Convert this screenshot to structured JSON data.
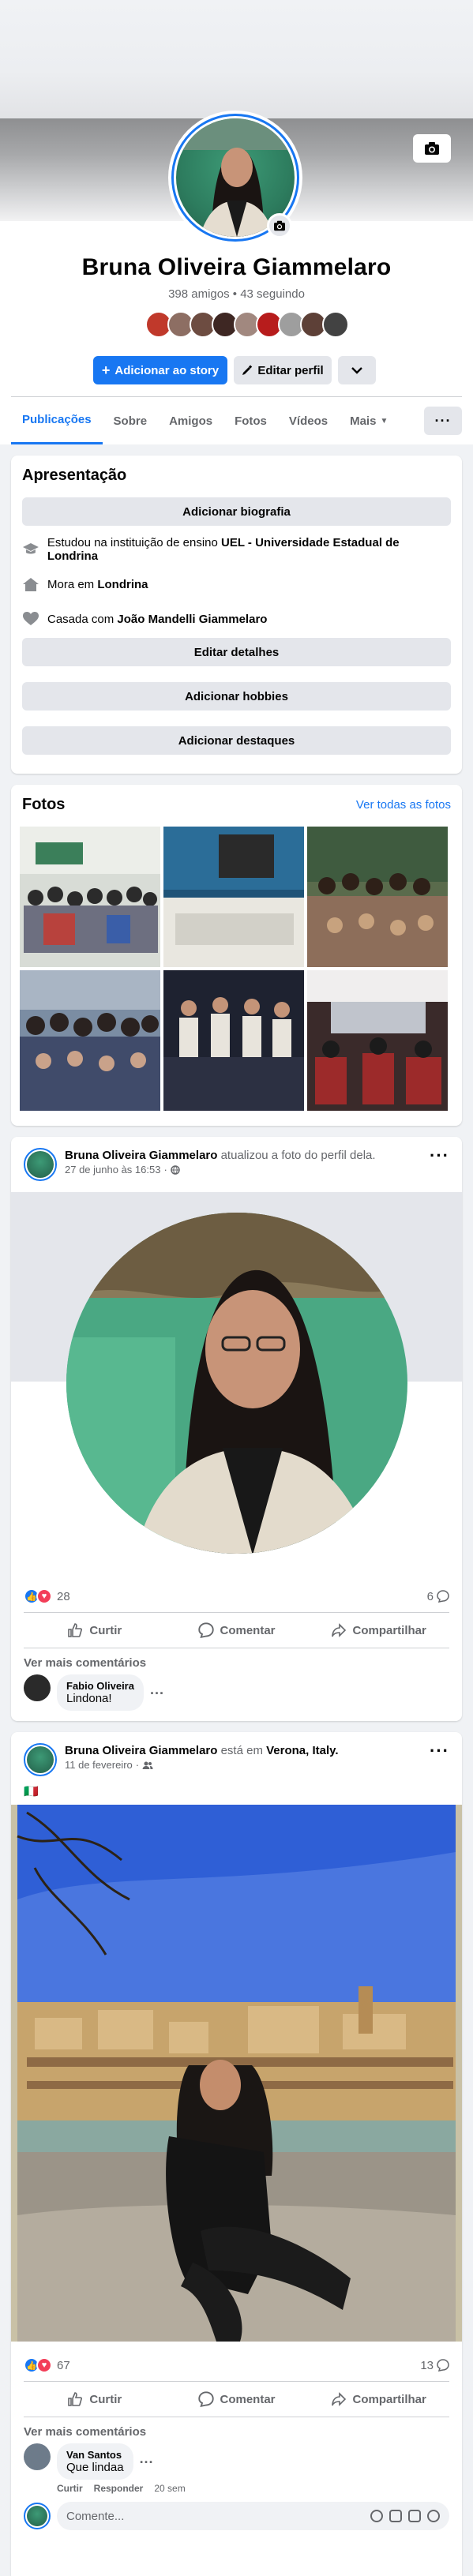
{
  "profile": {
    "name": "Bruna Oliveira Giammelaro",
    "counts": "398 amigos • 43 seguindo",
    "add_story": "Adicionar ao story",
    "edit_profile": "Editar perfil"
  },
  "tabs": [
    "Publicações",
    "Sobre",
    "Amigos",
    "Fotos",
    "Vídeos",
    "Mais"
  ],
  "intro": {
    "title": "Apresentação",
    "add_bio": "Adicionar biografia",
    "study_prefix": "Estudou na instituição de ensino",
    "study_place": "UEL - Universidade Estadual de Londrina",
    "lives_prefix": "Mora em",
    "lives_place": "Londrina",
    "married_prefix": "Casada com",
    "married_to": "João Mandelli Giammelaro",
    "edit_details": "Editar detalhes",
    "add_hobbies": "Adicionar hobbies",
    "add_highlights": "Adicionar destaques"
  },
  "photos": {
    "title": "Fotos",
    "see_all": "Ver todas as fotos"
  },
  "post1": {
    "author": "Bruna Oliveira Giammelaro",
    "action": "atualizou a foto do perfil dela.",
    "time": "27 de junho às 16:53",
    "reactions": "28",
    "comments": "6",
    "like": "Curtir",
    "comment": "Comentar",
    "share": "Compartilhar",
    "more_comments": "Ver mais comentários",
    "commenter": "Fabio Oliveira",
    "comment_text": "Lindona!"
  },
  "post2": {
    "author": "Bruna Oliveira Giammelaro",
    "action": "está em",
    "place": "Verona, Italy.",
    "time": "11 de fevereiro",
    "flag": "🇮🇹",
    "reactions": "67",
    "comments": "13",
    "like": "Curtir",
    "comment": "Comentar",
    "share": "Compartilhar",
    "more_comments": "Ver mais comentários",
    "commenter": "Van Santos",
    "comment_text": "Que lindaa",
    "c_like": "Curtir",
    "c_reply": "Responder",
    "c_time": "20 sem",
    "write_placeholder": "Comente..."
  }
}
